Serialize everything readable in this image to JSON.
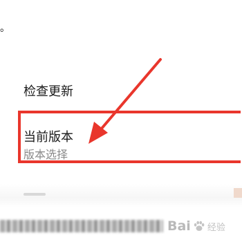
{
  "header": {
    "dot": "。"
  },
  "settings": {
    "check_update": {
      "title": "检查更新"
    },
    "current_version": {
      "title": "当前版本",
      "subtitle": "版本选择"
    }
  },
  "annotation": {
    "highlight_color": "#e9362c",
    "arrow_color": "#e9362c",
    "arrow_icon": "red-arrow-icon"
  },
  "watermark": {
    "brand": "Bai",
    "brand_tail": "经验",
    "icon": "baidu-paw-icon"
  }
}
